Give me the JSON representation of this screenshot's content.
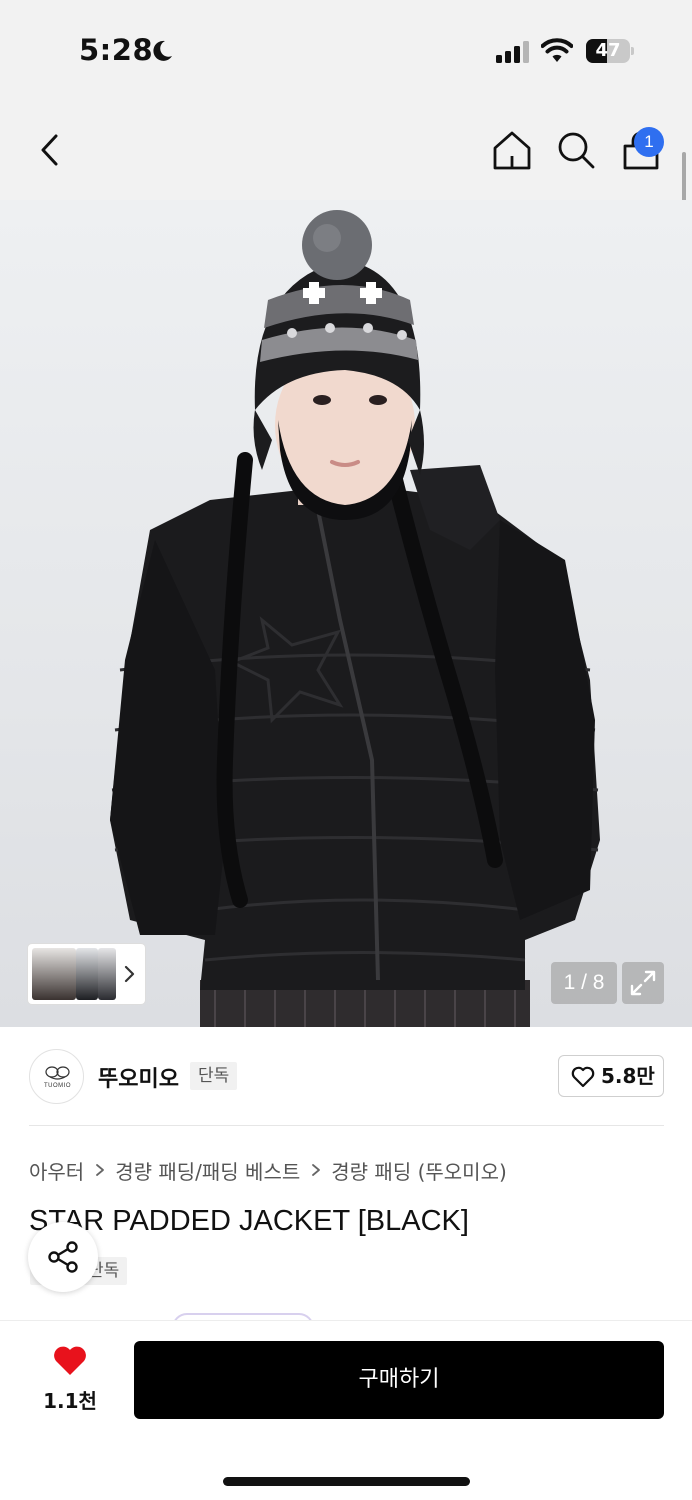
{
  "status_bar": {
    "time": "5:28",
    "battery": "47",
    "battery_level": 0.47
  },
  "nav": {
    "cart_count": "1"
  },
  "gallery": {
    "counter": "1 / 8"
  },
  "brand": {
    "logo_text": "TUOMIO",
    "name": "뚜오미오",
    "exclusive_label": "단독",
    "like_count": "5.8만"
  },
  "breadcrumb": [
    "아우터",
    "경량 패딩/패딩 베스트",
    "경량 패딩 (뚜오미오)"
  ],
  "product": {
    "title": "STAR PADDED JACKET [BLACK]",
    "tag": "단독"
  },
  "bottom_bar": {
    "wish_count": "1.1천",
    "buy_label": "구매하기"
  },
  "colors": {
    "accent_blue": "#2f6ff0",
    "heart_red": "#e8121c",
    "buy_button": "#000000"
  },
  "icons": [
    "moon-icon",
    "signal-icon",
    "wifi-icon",
    "back-icon",
    "home-icon",
    "search-icon",
    "shopping-bag-icon",
    "chevron-right-icon",
    "expand-icon",
    "heart-outline-icon",
    "share-icon",
    "heart-filled-icon"
  ]
}
